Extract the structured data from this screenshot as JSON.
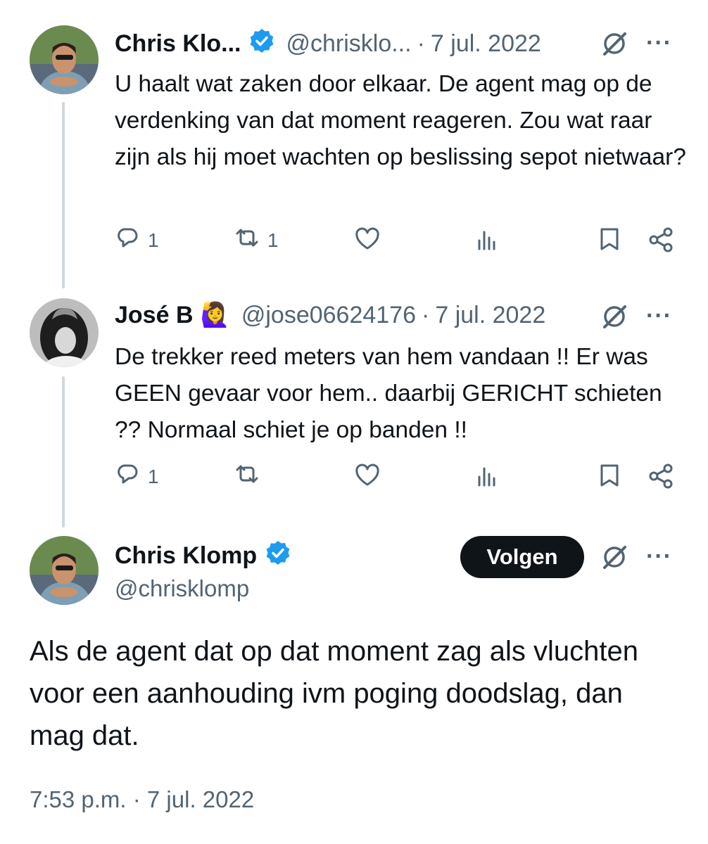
{
  "replies": [
    {
      "author_name": "Chris Klo...",
      "verified": true,
      "handle": "@chrisklo...",
      "date": "7 jul. 2022",
      "text": "U haalt wat zaken door elkaar. De agent mag op de verdenking van dat moment reageren. Zou wat raar zijn als hij moet wachten op beslissing sepot nietwaar?",
      "reply_count": "1",
      "repost_count": "1"
    },
    {
      "author_name": "José B",
      "emoji": "🙋‍♀️",
      "handle": "@jose06624176",
      "date": "7 jul. 2022",
      "text": "De trekker reed meters van hem vandaan !! Er was GEEN gevaar voor hem.. daarbij GERICHT schieten ?? Normaal schiet je op banden !!",
      "reply_count": "1",
      "repost_count": ""
    }
  ],
  "main_tweet": {
    "author_name": "Chris Klomp",
    "verified": true,
    "handle": "@chrisklomp",
    "follow_label": "Volgen",
    "text": "Als de agent dat op dat moment zag als vluchten voor een aanhouding ivm poging doodslag, dan mag dat.",
    "timestamp": "7:53 p.m. · 7 jul. 2022"
  },
  "separator": "·",
  "more_label": "···",
  "colors": {
    "text": "#0f1419",
    "secondary": "#536471",
    "verified": "#1d9bf0",
    "thread_line": "#cfd9de",
    "button": "#0f1419"
  },
  "icons": [
    "reply-icon",
    "repost-icon",
    "like-icon",
    "views-icon",
    "bookmark-icon",
    "share-icon",
    "grok-icon",
    "more-icon",
    "verified-badge-icon"
  ]
}
